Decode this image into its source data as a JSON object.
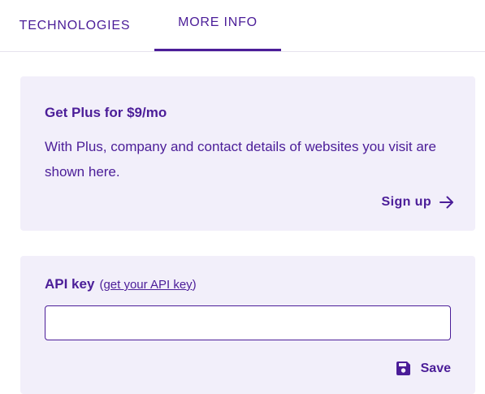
{
  "tabs": {
    "items": [
      {
        "label": "TECHNOLOGIES",
        "active": false
      },
      {
        "label": "MORE INFO",
        "active": true
      }
    ]
  },
  "plus_card": {
    "title": "Get Plus for $9/mo",
    "text": "With Plus, company and contact details of websites you visit are shown here.",
    "signup_label": "Sign up",
    "signup_icon": "arrow-right-icon"
  },
  "api_card": {
    "label": "API key",
    "link_open": "(",
    "link_text": "get your API key",
    "link_close": ")",
    "input_value": "",
    "input_placeholder": "",
    "save_label": "Save",
    "save_icon": "floppy-disk-icon"
  },
  "colors": {
    "accent": "#4b1d98",
    "card_background": "#f2effa",
    "divider": "#e6e3ee"
  }
}
